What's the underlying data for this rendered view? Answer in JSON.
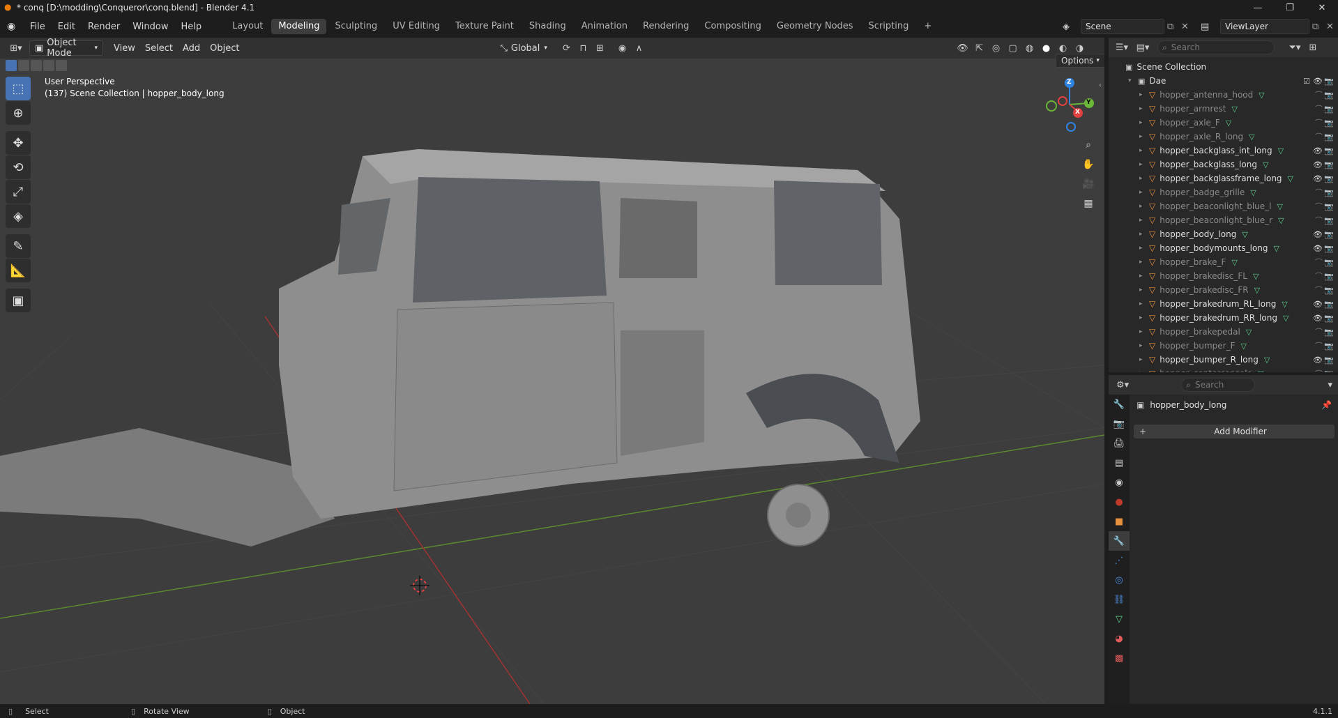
{
  "window": {
    "title": "* conq [D:\\modding\\Conqueror\\conq.blend] - Blender 4.1"
  },
  "menu": [
    "File",
    "Edit",
    "Render",
    "Window",
    "Help"
  ],
  "workspaces": [
    "Layout",
    "Modeling",
    "Sculpting",
    "UV Editing",
    "Texture Paint",
    "Shading",
    "Animation",
    "Rendering",
    "Compositing",
    "Geometry Nodes",
    "Scripting"
  ],
  "active_workspace": "Modeling",
  "scene": {
    "name": "Scene",
    "view_layer": "ViewLayer"
  },
  "viewport": {
    "mode": "Object Mode",
    "menus": [
      "View",
      "Select",
      "Add",
      "Object"
    ],
    "orientation": "Global",
    "options_label": "Options",
    "perspective_label": "User Perspective",
    "context_label": "(137) Scene Collection | hopper_body_long",
    "gizmo_axes": [
      "Z",
      "Y",
      "X"
    ]
  },
  "outliner": {
    "search_placeholder": "Search",
    "root": "Scene Collection",
    "collection": "Dae",
    "items": [
      {
        "name": "hopper_antenna_hood",
        "visible": false
      },
      {
        "name": "hopper_armrest",
        "visible": false
      },
      {
        "name": "hopper_axle_F",
        "visible": false
      },
      {
        "name": "hopper_axle_R_long",
        "visible": false
      },
      {
        "name": "hopper_backglass_int_long",
        "visible": true
      },
      {
        "name": "hopper_backglass_long",
        "visible": true
      },
      {
        "name": "hopper_backglassframe_long",
        "visible": true
      },
      {
        "name": "hopper_badge_grille",
        "visible": false
      },
      {
        "name": "hopper_beaconlight_blue_l",
        "visible": false
      },
      {
        "name": "hopper_beaconlight_blue_r",
        "visible": false
      },
      {
        "name": "hopper_body_long",
        "visible": true
      },
      {
        "name": "hopper_bodymounts_long",
        "visible": true
      },
      {
        "name": "hopper_brake_F",
        "visible": false
      },
      {
        "name": "hopper_brakedisc_FL",
        "visible": false
      },
      {
        "name": "hopper_brakedisc_FR",
        "visible": false
      },
      {
        "name": "hopper_brakedrum_RL_long",
        "visible": true
      },
      {
        "name": "hopper_brakedrum_RR_long",
        "visible": true
      },
      {
        "name": "hopper_brakepedal",
        "visible": false
      },
      {
        "name": "hopper_bumper_F",
        "visible": false
      },
      {
        "name": "hopper_bumper_R_long",
        "visible": true
      },
      {
        "name": "hopper_centerconsole",
        "visible": false
      }
    ]
  },
  "properties": {
    "search_placeholder": "Search",
    "object_name": "hopper_body_long",
    "add_modifier_label": "Add Modifier"
  },
  "status": {
    "select": "Select",
    "rotate": "Rotate View",
    "object": "Object",
    "version": "4.1.1"
  },
  "colors": {
    "accent": "#4772b3",
    "object_orange": "#e6903b",
    "mesh_green": "#5fd18f",
    "axis_x": "#e04040",
    "axis_y": "#6bb839",
    "axis_z": "#2f83e0"
  }
}
